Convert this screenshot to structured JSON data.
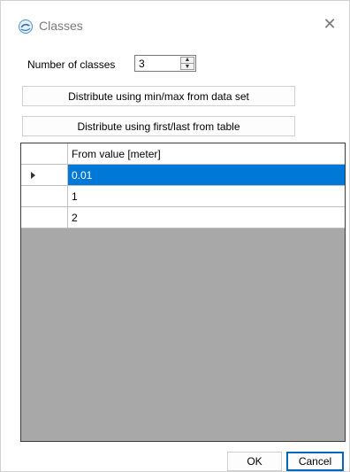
{
  "window": {
    "title": "Classes",
    "icon": "dolphin-app-icon",
    "close_glyph": "✕"
  },
  "form": {
    "number_of_classes_label": "Number of classes",
    "number_of_classes_value": "3",
    "distribute_minmax_label": "Distribute using min/max from data set",
    "distribute_firstlast_label": "Distribute using first/last from table"
  },
  "table": {
    "header": "From value [meter]",
    "rows": [
      "0.01",
      "1",
      "2"
    ],
    "selected_row": 0
  },
  "footer": {
    "ok_label": "OK",
    "cancel_label": "Cancel"
  },
  "colors": {
    "selection": "#0078d7",
    "grid_background": "#a8a8a8"
  }
}
